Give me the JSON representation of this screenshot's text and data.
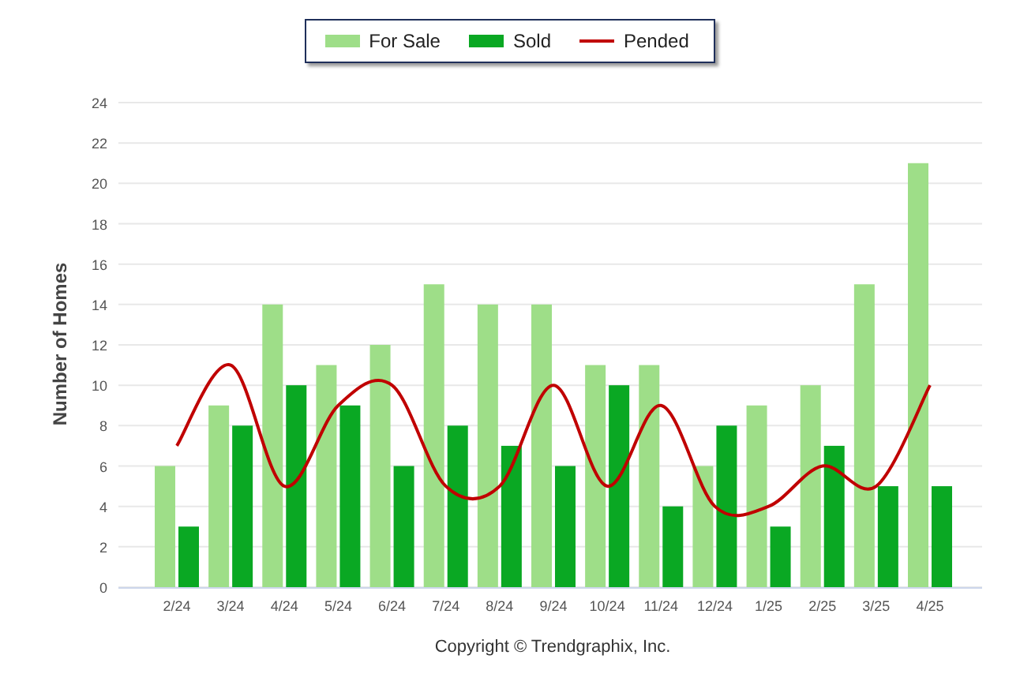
{
  "chart_data": {
    "type": "bar",
    "ylabel": "Number of Homes",
    "categories": [
      "2/24",
      "3/24",
      "4/24",
      "5/24",
      "6/24",
      "7/24",
      "8/24",
      "9/24",
      "10/24",
      "11/24",
      "12/24",
      "1/25",
      "2/25",
      "3/25",
      "4/25"
    ],
    "ylim": [
      0,
      24
    ],
    "grid": true,
    "yticks": [
      0,
      2,
      4,
      6,
      8,
      10,
      12,
      14,
      16,
      18,
      20,
      22,
      24
    ],
    "series": [
      {
        "name": "For Sale",
        "color": "#9ede88",
        "values": [
          6,
          9,
          14,
          11,
          12,
          15,
          14,
          14,
          11,
          11,
          6,
          9,
          10,
          15,
          21
        ]
      },
      {
        "name": "Sold",
        "color": "#0aa823",
        "values": [
          3,
          8,
          10,
          9,
          6,
          8,
          7,
          6,
          10,
          4,
          8,
          3,
          7,
          5,
          5
        ]
      },
      {
        "name": "Pended",
        "type": "line",
        "color": "#c00000",
        "values": [
          7,
          11,
          5,
          9,
          10,
          5,
          5,
          10,
          5,
          9,
          4,
          4,
          6,
          5,
          10
        ]
      }
    ]
  },
  "copyright": "Copyright © Trendgraphix, Inc."
}
